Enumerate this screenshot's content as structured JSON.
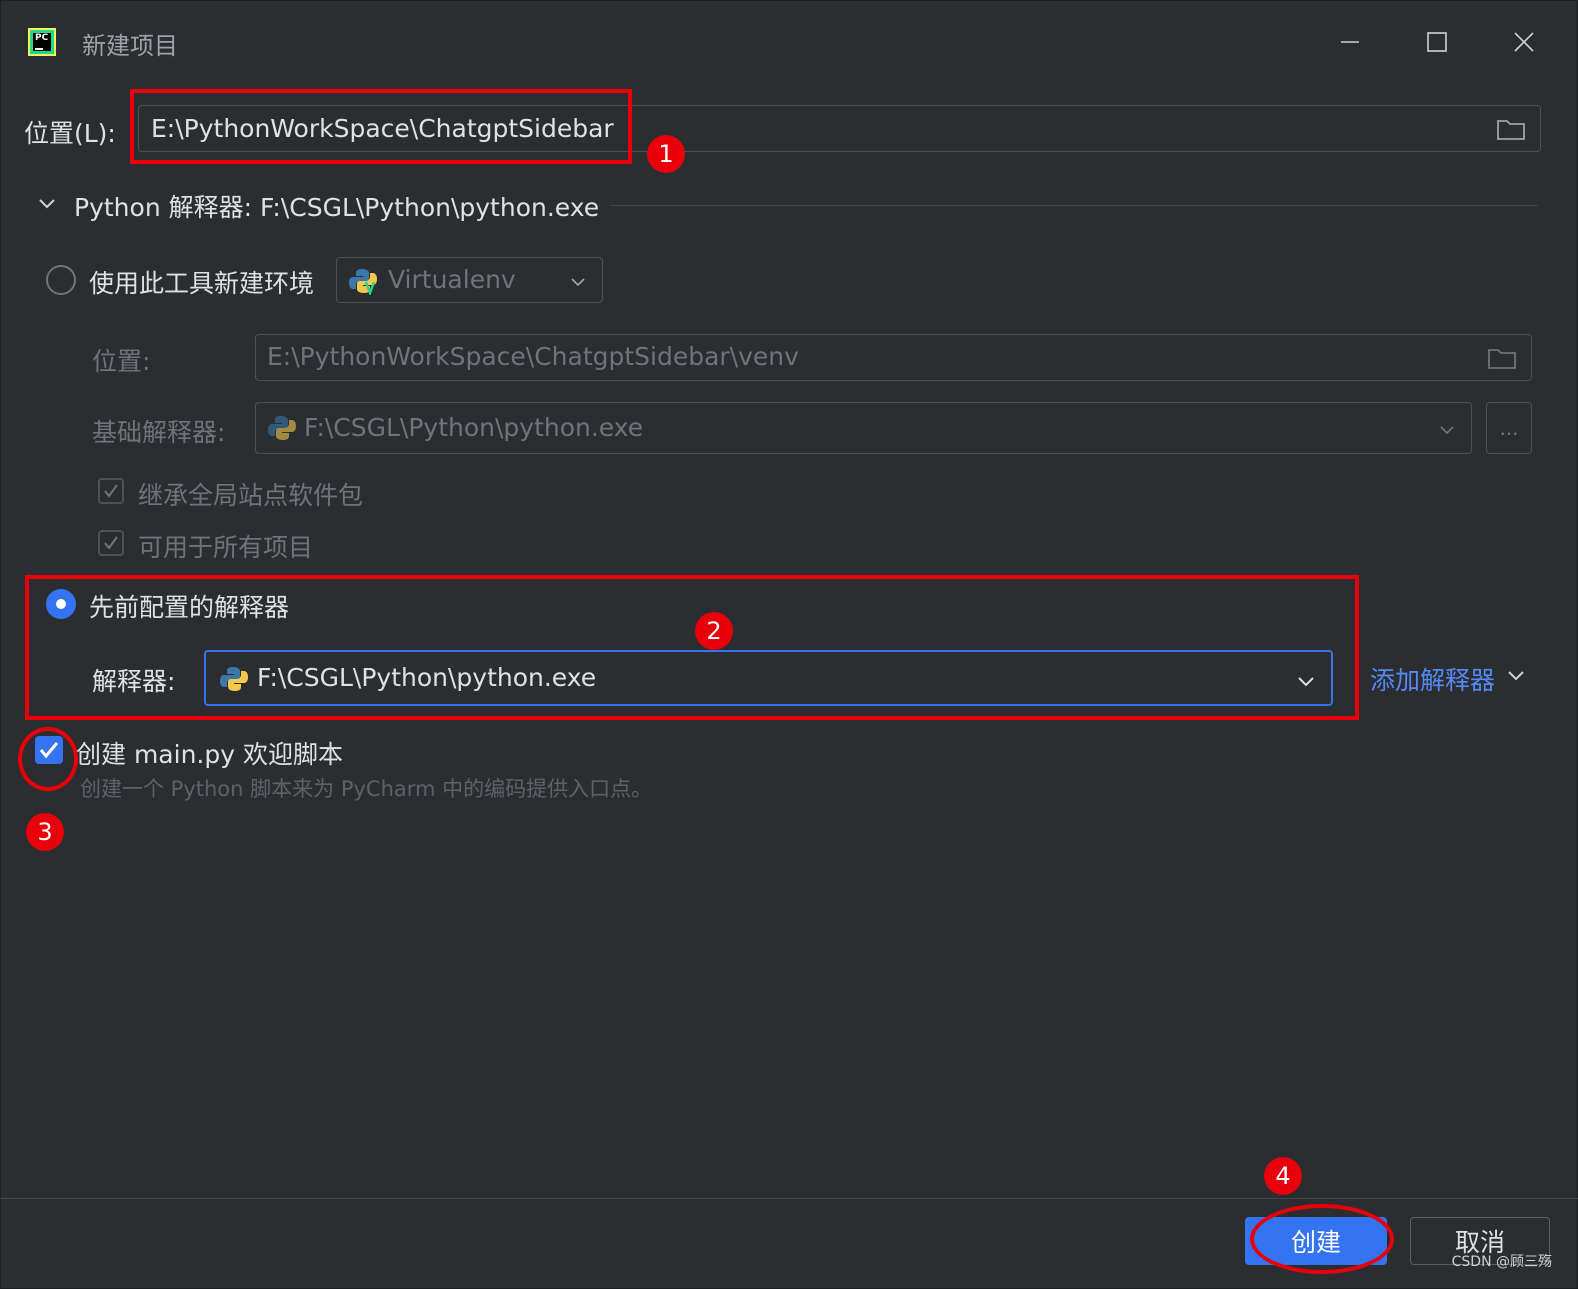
{
  "window": {
    "title": "新建项目",
    "app_icon_text": "PC"
  },
  "location": {
    "label": "位置(L):",
    "value": "E:\\PythonWorkSpace\\ChatgptSidebar"
  },
  "interpreter_section": {
    "header": "Python 解释器: F:\\CSGL\\Python\\python.exe"
  },
  "new_env": {
    "radio_label": "使用此工具新建环境",
    "tool_value": "Virtualenv",
    "location_label": "位置:",
    "location_value": "E:\\PythonWorkSpace\\ChatgptSidebar\\venv",
    "base_label": "基础解释器:",
    "base_value": "F:\\CSGL\\Python\\python.exe",
    "browse_label": "...",
    "inherit_label": "继承全局站点软件包",
    "available_label": "可用于所有项目"
  },
  "existing": {
    "radio_label": "先前配置的解释器",
    "interpreter_label": "解释器:",
    "interpreter_value": "F:\\CSGL\\Python\\python.exe",
    "add_link": "添加解释器"
  },
  "welcome": {
    "checkbox_label": "创建 main.py 欢迎脚本",
    "description": "创建一个 Python 脚本来为 PyCharm 中的编码提供入口点。"
  },
  "annotations": [
    "1",
    "2",
    "3",
    "4"
  ],
  "footer": {
    "create": "创建",
    "cancel": "取消",
    "watermark": "CSDN @顾三殇"
  },
  "colors": {
    "background": "#2b2d30",
    "accent": "#3574f0",
    "link": "#548af7",
    "annotation": "#e8000b"
  }
}
